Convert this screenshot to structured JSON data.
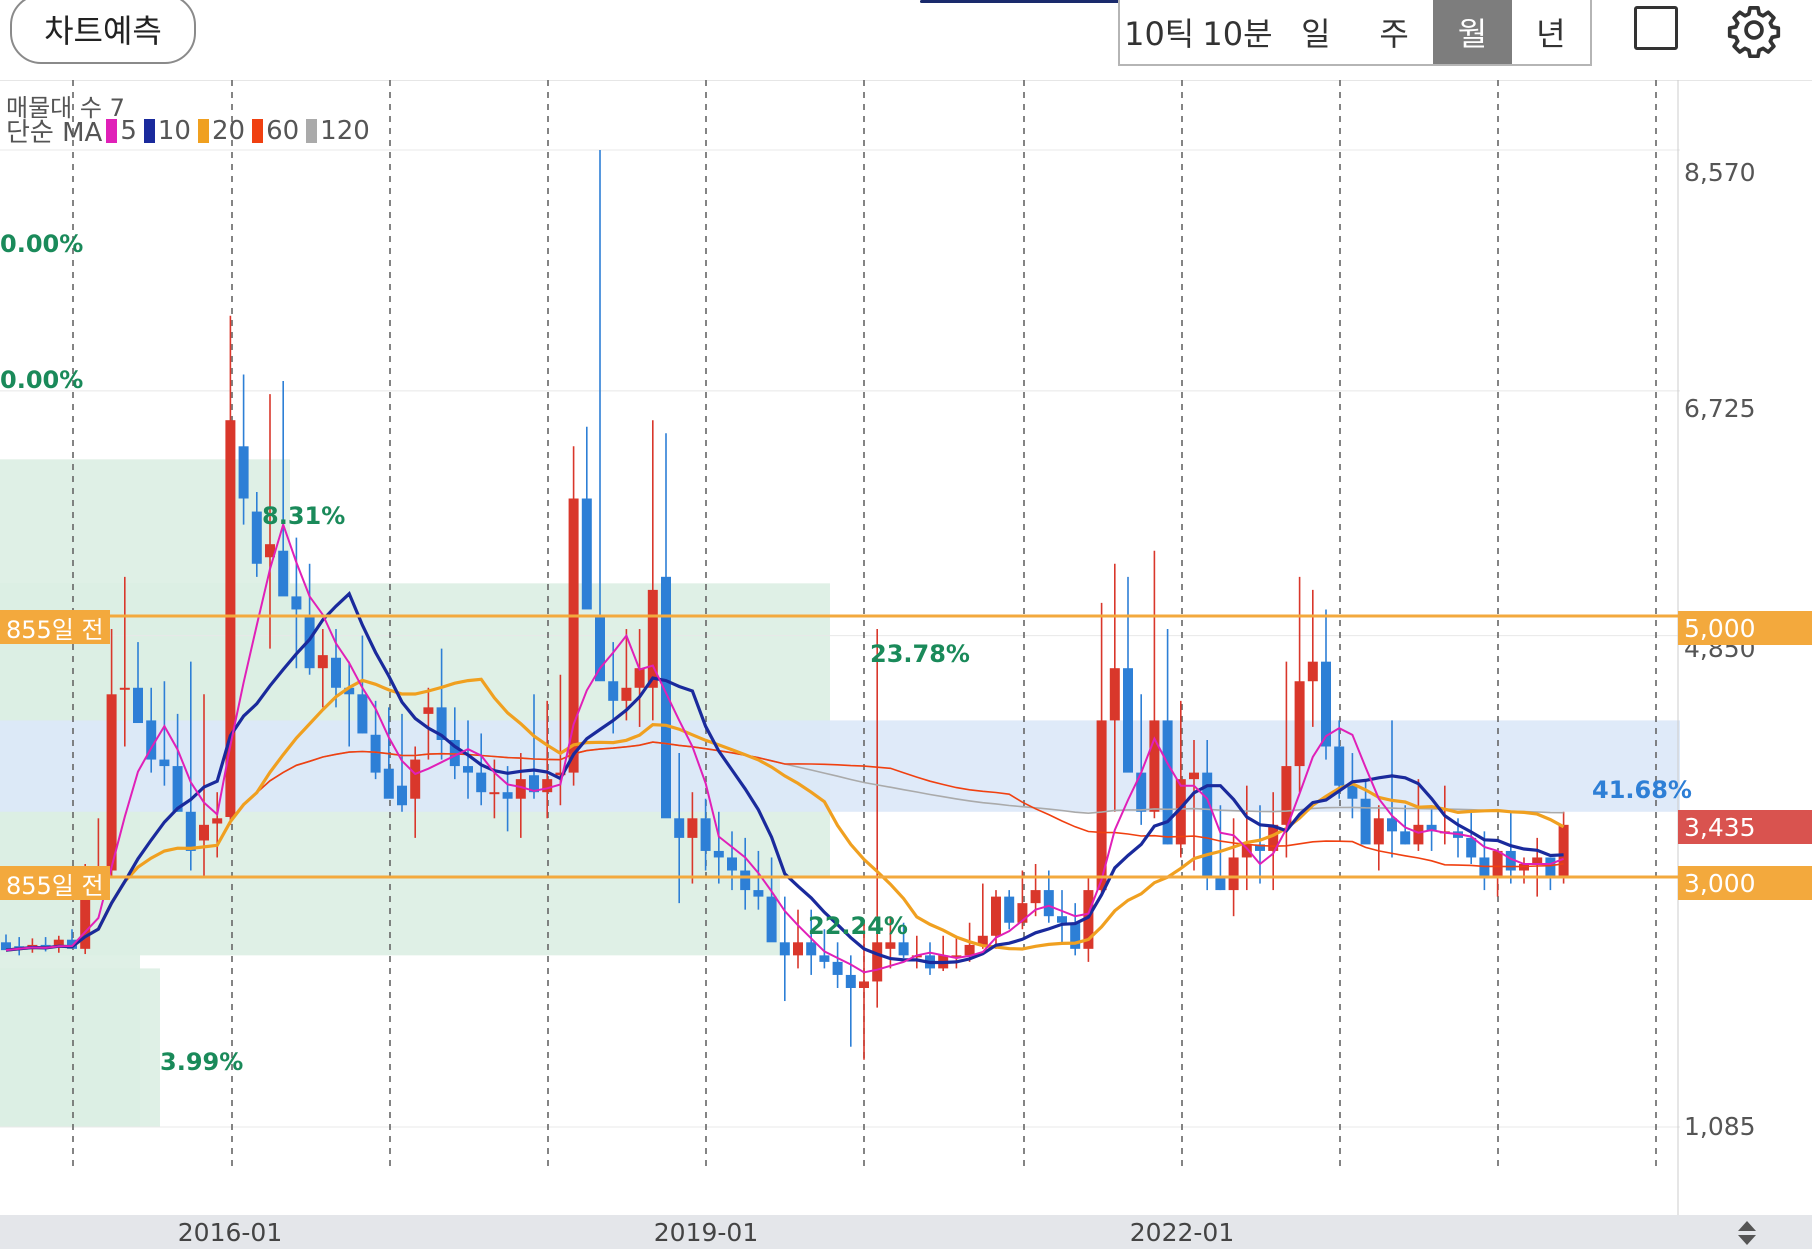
{
  "toolbar": {
    "predict_label": "차트예측",
    "periods": [
      "10틱",
      "10분",
      "일",
      "주",
      "월",
      "년"
    ],
    "active_period": "월",
    "icons": [
      "square-icon",
      "gear-icon"
    ]
  },
  "indicator": {
    "volume_profile_label": "매물대 수 7",
    "ma_label": "단순 MA",
    "ma_periods": [
      {
        "num": "5",
        "color": "#e020b8"
      },
      {
        "num": "10",
        "color": "#1a2a9c"
      },
      {
        "num": "20",
        "color": "#f0a020"
      },
      {
        "num": "60",
        "color": "#f04010"
      },
      {
        "num": "120",
        "color": "#aaaaaa"
      }
    ]
  },
  "zone_labels": {
    "z1": "0.00%",
    "z2": "0.00%",
    "z3": "8.31%",
    "z4": "23.78%",
    "z5": "22.24%",
    "z6": "3.99%",
    "z7": "41.68%"
  },
  "horizontal_lines": {
    "upper_tag": "855일 전",
    "lower_tag": "855일 전"
  },
  "price_tags": {
    "upper": "5,000",
    "current": "3,435",
    "lower": "3,000"
  },
  "y_ticks": [
    "8,570",
    "6,725",
    "4,850",
    "1,085"
  ],
  "x_ticks": [
    "2016-01",
    "2019-01",
    "2022-01"
  ],
  "colors": {
    "up": "#d9372b",
    "down": "#2d7fd6",
    "zone_green": "#dbeee3",
    "zone_blue": "#dce8f8",
    "hline": "#f3a93d"
  },
  "chart_data": {
    "type": "candlestick",
    "interval": "monthly",
    "ylim": [
      1085,
      8570
    ],
    "horizontal_levels": [
      5000,
      3000
    ],
    "current_price": 3435,
    "x_ticks": [
      "2016-01",
      "2019-01",
      "2022-01"
    ],
    "y_ticks": [
      1085,
      4850,
      6725,
      8570
    ],
    "candles": [
      [
        2500,
        2560,
        2450,
        2440
      ],
      [
        2470,
        2540,
        2400,
        2460
      ],
      [
        2460,
        2530,
        2420,
        2480
      ],
      [
        2480,
        2540,
        2430,
        2450
      ],
      [
        2460,
        2550,
        2420,
        2520
      ],
      [
        2520,
        2600,
        2470,
        2450
      ],
      [
        2450,
        3100,
        2410,
        3000
      ],
      [
        2990,
        3450,
        2950,
        3010
      ],
      [
        3050,
        4900,
        3000,
        4400
      ],
      [
        4440,
        5300,
        4000,
        4450
      ],
      [
        4450,
        4800,
        4200,
        4180
      ],
      [
        4200,
        4450,
        3800,
        3900
      ],
      [
        3900,
        4500,
        3700,
        3850
      ],
      [
        3850,
        4250,
        3500,
        3500
      ],
      [
        3500,
        4650,
        3050,
        3200
      ],
      [
        3280,
        4400,
        3000,
        3400
      ],
      [
        3410,
        3650,
        3150,
        3450
      ],
      [
        3460,
        7300,
        3400,
        6500
      ],
      [
        6300,
        6850,
        5700,
        5900
      ],
      [
        5800,
        5950,
        5300,
        5400
      ],
      [
        5450,
        6700,
        4750,
        5550
      ],
      [
        5500,
        6800,
        5200,
        5150
      ],
      [
        5150,
        5600,
        4600,
        5050
      ],
      [
        5000,
        5400,
        4550,
        4600
      ],
      [
        4600,
        4900,
        4300,
        4700
      ],
      [
        4680,
        4900,
        4300,
        4450
      ],
      [
        4450,
        4650,
        4000,
        4400
      ],
      [
        4400,
        4850,
        4100,
        4100
      ],
      [
        4090,
        4350,
        3750,
        3800
      ],
      [
        3830,
        4300,
        3750,
        3600
      ],
      [
        3700,
        4250,
        3500,
        3550
      ],
      [
        3600,
        4000,
        3300,
        3900
      ],
      [
        4250,
        4450,
        3900,
        4300
      ],
      [
        4300,
        4750,
        3900,
        4050
      ],
      [
        4050,
        4300,
        3750,
        3850
      ],
      [
        3850,
        4200,
        3600,
        3800
      ],
      [
        3800,
        4100,
        3550,
        3650
      ],
      [
        3650,
        3900,
        3450,
        3650
      ],
      [
        3650,
        3850,
        3350,
        3600
      ],
      [
        3600,
        3950,
        3300,
        3750
      ],
      [
        3780,
        4400,
        3600,
        3650
      ],
      [
        3650,
        4350,
        3450,
        3750
      ],
      [
        3780,
        4550,
        3550,
        3800
      ],
      [
        3800,
        6300,
        3700,
        5900
      ],
      [
        5900,
        6450,
        5400,
        5050
      ],
      [
        5000,
        8570,
        4700,
        4500
      ],
      [
        4500,
        4800,
        4100,
        4350
      ],
      [
        4350,
        4900,
        4200,
        4450
      ],
      [
        4450,
        4900,
        4150,
        4600
      ],
      [
        4450,
        6500,
        4200,
        5200
      ],
      [
        5300,
        6400,
        4950,
        3450
      ],
      [
        3450,
        3950,
        2800,
        3300
      ],
      [
        3300,
        3650,
        2950,
        3450
      ],
      [
        3450,
        3600,
        3050,
        3200
      ],
      [
        3200,
        3500,
        2950,
        3150
      ],
      [
        3150,
        3350,
        2900,
        3050
      ],
      [
        3050,
        3300,
        2750,
        2900
      ],
      [
        2900,
        3200,
        2750,
        2850
      ],
      [
        2850,
        3150,
        2600,
        2500
      ],
      [
        2500,
        2850,
        2050,
        2400
      ],
      [
        2400,
        2750,
        2300,
        2500
      ],
      [
        2500,
        2750,
        2250,
        2400
      ],
      [
        2400,
        2600,
        2300,
        2350
      ],
      [
        2350,
        2500,
        2150,
        2250
      ],
      [
        2250,
        2400,
        1700,
        2150
      ],
      [
        2150,
        2650,
        1600,
        2200
      ],
      [
        2200,
        4900,
        2000,
        2500
      ],
      [
        2450,
        2700,
        2300,
        2500
      ],
      [
        2500,
        2650,
        2380,
        2400
      ],
      [
        2400,
        2550,
        2300,
        2400
      ],
      [
        2400,
        2500,
        2250,
        2300
      ],
      [
        2300,
        2550,
        2280,
        2400
      ],
      [
        2380,
        2550,
        2300,
        2400
      ],
      [
        2400,
        2650,
        2350,
        2480
      ],
      [
        2480,
        2950,
        2450,
        2550
      ],
      [
        2550,
        2900,
        2450,
        2850
      ],
      [
        2850,
        2900,
        2600,
        2650
      ],
      [
        2650,
        3050,
        2600,
        2800
      ],
      [
        2800,
        3100,
        2700,
        2900
      ],
      [
        2900,
        3050,
        2650,
        2700
      ],
      [
        2700,
        2900,
        2500,
        2650
      ],
      [
        2650,
        2800,
        2400,
        2450
      ],
      [
        2450,
        3000,
        2350,
        2900
      ],
      [
        2900,
        5100,
        2850,
        4200
      ],
      [
        4200,
        5400,
        3500,
        4600
      ],
      [
        4600,
        5300,
        3900,
        3800
      ],
      [
        3800,
        4400,
        3400,
        3500
      ],
      [
        3500,
        5500,
        3450,
        4200
      ],
      [
        4200,
        4900,
        3250,
        3250
      ],
      [
        3250,
        4350,
        3150,
        3750
      ],
      [
        3750,
        4050,
        3050,
        3800
      ],
      [
        3800,
        4050,
        2900,
        3000
      ],
      [
        3000,
        3550,
        2900,
        2900
      ],
      [
        2900,
        3450,
        2700,
        3150
      ],
      [
        3150,
        3700,
        2900,
        3250
      ],
      [
        3250,
        3550,
        2950,
        3200
      ],
      [
        3200,
        3650,
        2900,
        3400
      ],
      [
        3400,
        4650,
        3150,
        3850
      ],
      [
        3850,
        5300,
        3650,
        4500
      ],
      [
        4500,
        5200,
        4150,
        4650
      ],
      [
        4650,
        5050,
        3900,
        4000
      ],
      [
        4000,
        4200,
        3600,
        3700
      ],
      [
        3700,
        3950,
        3450,
        3600
      ],
      [
        3600,
        3750,
        3350,
        3250
      ],
      [
        3250,
        3550,
        3050,
        3450
      ],
      [
        3450,
        4200,
        3150,
        3350
      ],
      [
        3350,
        3550,
        3250,
        3250
      ],
      [
        3250,
        3750,
        3200,
        3400
      ],
      [
        3400,
        3550,
        3200,
        3350
      ],
      [
        3350,
        3700,
        3250,
        3350
      ],
      [
        3350,
        3450,
        3150,
        3300
      ],
      [
        3300,
        3500,
        3100,
        3150
      ],
      [
        3150,
        3350,
        2900,
        3000
      ],
      [
        3000,
        3150,
        2850,
        3200
      ],
      [
        3200,
        3500,
        2950,
        3050
      ],
      [
        3050,
        3150,
        2950,
        3100
      ],
      [
        3100,
        3300,
        2850,
        3150
      ],
      [
        3150,
        3150,
        2900,
        3000
      ],
      [
        3000,
        3500,
        2950,
        3400
      ]
    ]
  }
}
